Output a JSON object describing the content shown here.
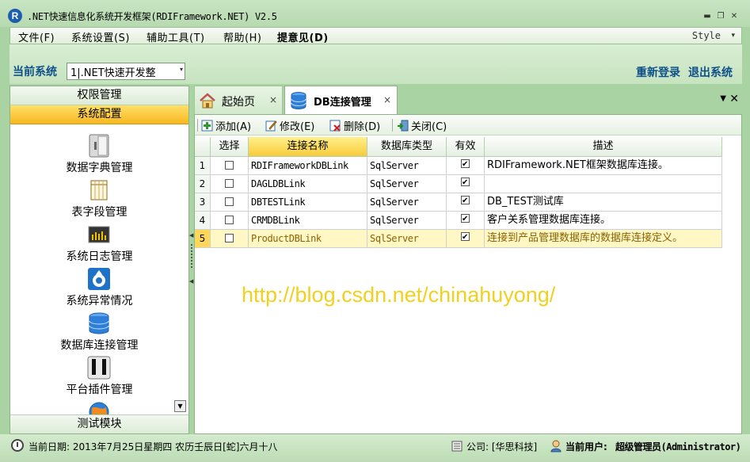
{
  "window": {
    "title": ".NET快速信息化系统开发框架(RDIFramework.NET) V2.5",
    "logo_letter": "R",
    "min_glyph": "▬",
    "max_glyph": "❐",
    "close_glyph": "✕"
  },
  "menu": {
    "items": [
      "文件(F)",
      "系统设置(S)",
      "辅助工具(T)",
      "帮助(H)",
      "提意见(D)"
    ],
    "style_label": "Style",
    "style_arrow": "▾"
  },
  "system_bar": {
    "label": "当前系统",
    "current": "1|.NET快速开发整",
    "combo_arrow": "▾",
    "relogin": "重新登录",
    "exit": "退出系统"
  },
  "nav": {
    "permission": "权限管理",
    "config": "系统配置",
    "items": [
      {
        "label": "数据字典管理",
        "icon": "dictionary-icon"
      },
      {
        "label": "表字段管理",
        "icon": "table-field-icon"
      },
      {
        "label": "系统日志管理",
        "icon": "log-icon"
      },
      {
        "label": "系统异常情况",
        "icon": "exception-icon"
      },
      {
        "label": "数据库连接管理",
        "icon": "database-icon"
      },
      {
        "label": "平台插件管理",
        "icon": "plugin-icon"
      },
      {
        "label": "",
        "icon": "globe-icon"
      }
    ],
    "scroll_glyph": "▼",
    "test": "测试模块"
  },
  "tabs": {
    "home": "起始页",
    "db": "DB连接管理",
    "close_glyph": "×",
    "menu_glyph": "▼",
    "strip_close": "✕"
  },
  "toolbar": {
    "add": "添加(A)",
    "edit": "修改(E)",
    "delete": "删除(D)",
    "close": "关闭(C)"
  },
  "grid": {
    "headers": [
      "选择",
      "连接名称",
      "数据库类型",
      "有效",
      "描述"
    ],
    "rows": [
      {
        "num": "1",
        "name": "RDIFrameworkDBLink",
        "type": "SqlServer",
        "selected": false,
        "valid": true,
        "desc": "RDIFramework.NET框架数据库连接。"
      },
      {
        "num": "2",
        "name": "DAGLDBLink",
        "type": "SqlServer",
        "selected": false,
        "valid": true,
        "desc": ""
      },
      {
        "num": "3",
        "name": "DBTESTLink",
        "type": "SqlServer",
        "selected": false,
        "valid": true,
        "desc": "DB_TEST测试库"
      },
      {
        "num": "4",
        "name": "CRMDBLink",
        "type": "SqlServer",
        "selected": false,
        "valid": true,
        "desc": "客户关系管理数据库连接。"
      },
      {
        "num": "5",
        "name": "ProductDBLink",
        "type": "SqlServer",
        "selected": false,
        "valid": true,
        "desc": "连接到产品管理数据库的数据库连接定义。"
      }
    ],
    "active_row": 4
  },
  "watermark": "http://blog.csdn.net/chinahuyong/",
  "status": {
    "date": "当前日期: 2013年7月25日星期四 农历壬辰日[蛇]六月十八",
    "company": "公司: [华思科技]",
    "user_label": "当前用户:",
    "user": "超级管理员(Administrator)"
  },
  "colors": {
    "frame": "#a9d3a2",
    "accent_yellow": "#f7b721",
    "link_blue": "#0e4f8a",
    "watermark": "#f0d020"
  }
}
